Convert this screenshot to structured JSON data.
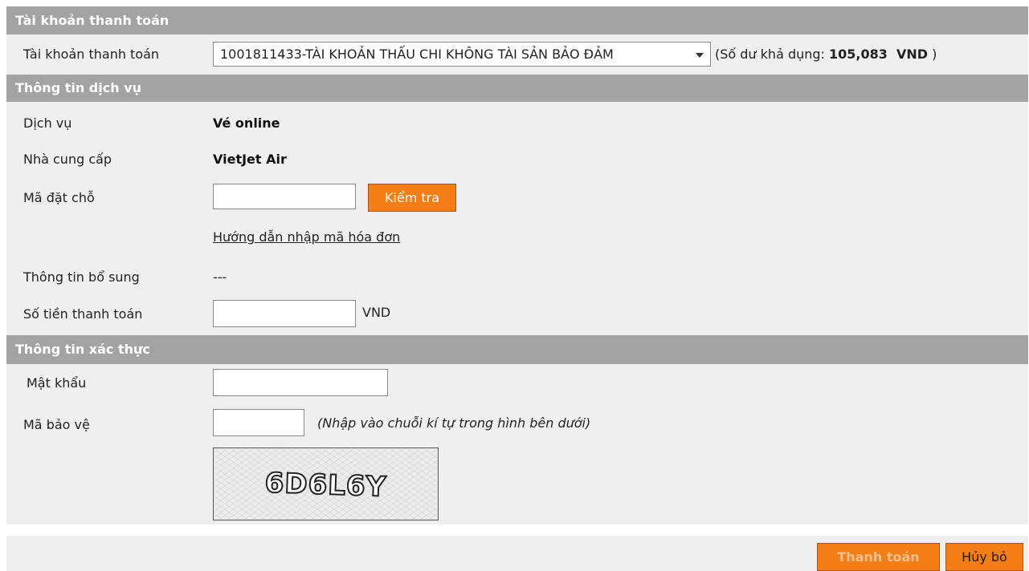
{
  "account_section": {
    "header": "Tài khoản thanh toán",
    "label": "Tài khoản thanh toán",
    "selected_account": "1001811433-TÀI KHOẢN THẤU CHI KHÔNG TÀI SẢN BẢO ĐẢM",
    "balance_prefix": "(Số dư khả dụng:",
    "balance_amount": "105,083",
    "balance_currency": "VND",
    "balance_suffix": ")"
  },
  "service_section": {
    "header": "Thông tin dịch vụ",
    "service_label": "Dịch vụ",
    "service_value": "Vé online",
    "provider_label": "Nhà cung cấp",
    "provider_value": "VietJet Air",
    "booking_code_label": "Mã đặt chỗ",
    "booking_code_value": "",
    "check_button": "Kiểm tra",
    "guide_link": "Hướng dẫn nhập mã hóa đơn",
    "extra_info_label": "Thông tin bổ sung",
    "extra_info_value": "---",
    "amount_label": "Số tiền thanh toán",
    "amount_value": "",
    "amount_unit": "VND"
  },
  "auth_section": {
    "header": "Thông tin xác thực",
    "password_label": "Mật khẩu",
    "password_value": "",
    "captcha_label": "Mã bảo vệ",
    "captcha_value": "",
    "captcha_hint": "(Nhập vào chuỗi kí tự trong hình bên dưới)",
    "captcha_image_text": "6D6L6Y"
  },
  "actions": {
    "pay_button": "Thanh toán",
    "cancel_button": "Hủy bỏ"
  },
  "colors": {
    "header_bg": "#a3a3a3",
    "panel_bg": "#efefef",
    "accent_orange": "#f57d16"
  }
}
